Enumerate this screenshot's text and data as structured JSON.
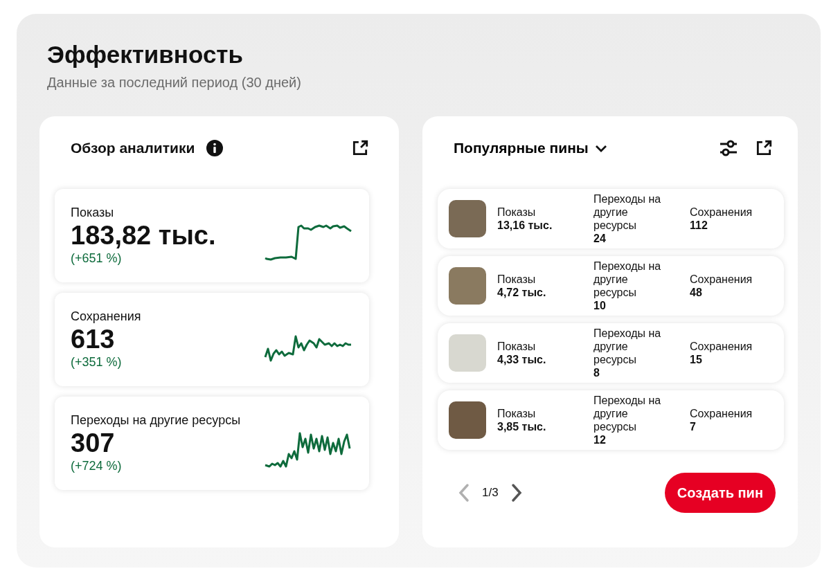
{
  "title": "Эффективность",
  "subtitle": "Данные за последний период (30 дней)",
  "overview": {
    "title": "Обзор аналитики",
    "metrics": [
      {
        "label": "Показы",
        "value": "183,82 тыс.",
        "change": "(+651 %)"
      },
      {
        "label": "Сохранения",
        "value": "613",
        "change": "(+351 %)"
      },
      {
        "label": "Переходы на другие ресурсы",
        "value": "307",
        "change": "(+724 %)"
      }
    ]
  },
  "pins": {
    "title": "Популярные пины",
    "rows": [
      {
        "impressions_label": "Показы",
        "impressions": "13,16 тыс.",
        "clicks_label": "Переходы на другие ресурсы",
        "clicks": "24",
        "saves_label": "Сохранения",
        "saves": "112"
      },
      {
        "impressions_label": "Показы",
        "impressions": "4,72 тыс.",
        "clicks_label": "Переходы на другие ресурсы",
        "clicks": "10",
        "saves_label": "Сохранения",
        "saves": "48"
      },
      {
        "impressions_label": "Показы",
        "impressions": "4,33 тыс.",
        "clicks_label": "Переходы на другие ресурсы",
        "clicks": "8",
        "saves_label": "Сохранения",
        "saves": "15"
      },
      {
        "impressions_label": "Показы",
        "impressions": "3,85 тыс.",
        "clicks_label": "Переходы на другие ресурсы",
        "clicks": "12",
        "saves_label": "Сохранения",
        "saves": "7"
      }
    ],
    "pager": {
      "text": "1/3",
      "prev_disabled": true,
      "next_disabled": false
    },
    "create_button": "Создать пин"
  }
}
